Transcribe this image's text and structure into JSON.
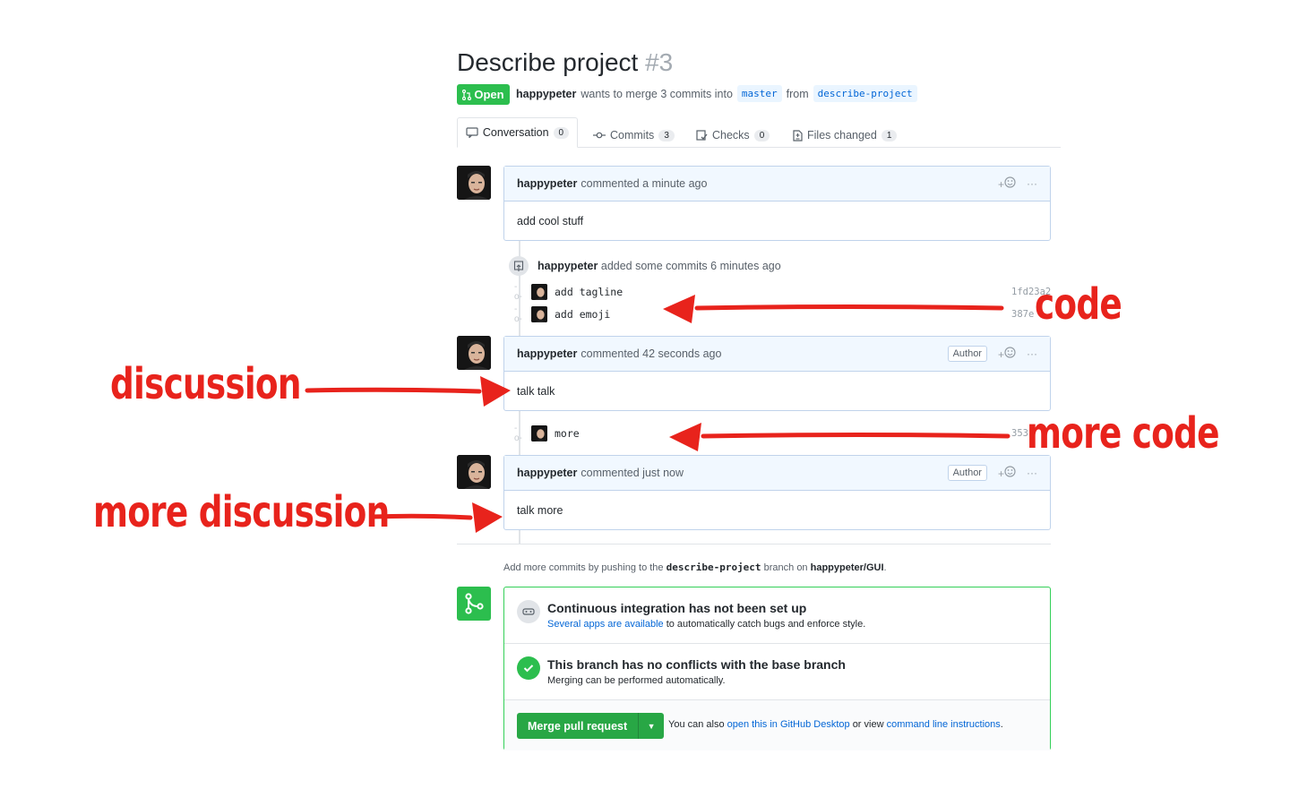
{
  "pr": {
    "title": "Describe project",
    "number": "#3",
    "status": "Open",
    "user": "happypeter",
    "merge_text": "wants to merge 3 commits into",
    "base_branch": "master",
    "from_text": "from",
    "head_branch": "describe-project"
  },
  "tabs": [
    {
      "label": "Conversation",
      "count": "0",
      "icon": "comment-icon"
    },
    {
      "label": "Commits",
      "count": "3",
      "icon": "commit-icon"
    },
    {
      "label": "Checks",
      "count": "0",
      "icon": "checklist-icon"
    },
    {
      "label": "Files changed",
      "count": "1",
      "icon": "file-diff-icon"
    }
  ],
  "comments": [
    {
      "author": "happypeter",
      "time": "commented a minute ago",
      "body": "add cool stuff",
      "badge": ""
    },
    {
      "author": "happypeter",
      "time": "commented 42 seconds ago",
      "body": "talk talk",
      "badge": "Author"
    },
    {
      "author": "happypeter",
      "time": "commented just now",
      "body": "talk more",
      "badge": "Author"
    }
  ],
  "commit_event": {
    "author": "happypeter",
    "text": "added some commits 6 minutes ago"
  },
  "commits": [
    {
      "message": "add tagline",
      "sha": "1fd23a2"
    },
    {
      "message": "add emoji",
      "sha": "387e"
    },
    {
      "message": "more",
      "sha": "353"
    }
  ],
  "reactions": {
    "add": "+",
    "more": "···"
  },
  "push_hint": {
    "prefix": "Add more commits by pushing to the",
    "branch": "describe-project",
    "mid": "branch on",
    "repo": "happypeter/GUI",
    "suffix": "."
  },
  "merge_box": {
    "ci_title": "Continuous integration has not been set up",
    "ci_link": "Several apps are available",
    "ci_rest": "to automatically catch bugs and enforce style.",
    "conflict_title": "This branch has no conflicts with the base branch",
    "conflict_sub": "Merging can be performed automatically.",
    "merge_button": "Merge pull request",
    "also_prefix": "You can also",
    "desktop_link": "open this in GitHub Desktop",
    "or_view": "or view",
    "cli_link": "command line instructions",
    "period": "."
  },
  "annotations": {
    "code": "code",
    "discussion": "discussion",
    "more_code": "more code",
    "more_discussion": "more discussion"
  },
  "colors": {
    "open_green": "#2cbe4e",
    "link_blue": "#0366d6",
    "annotation_red": "#e8231c",
    "comment_header": "#f1f8ff"
  }
}
